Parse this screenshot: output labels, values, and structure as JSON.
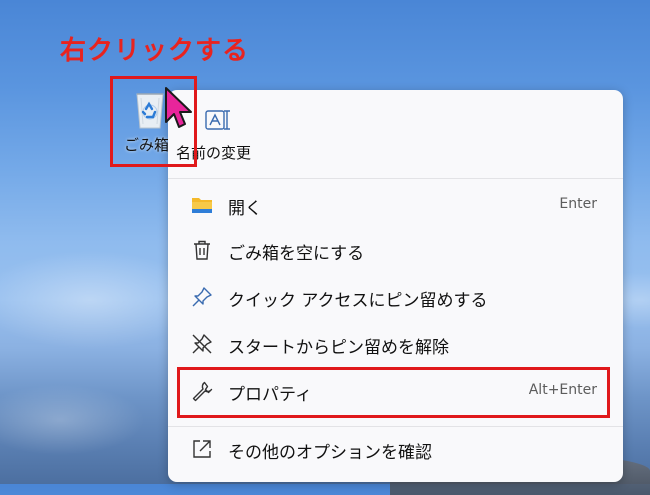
{
  "annotation": {
    "text": "右クリックする",
    "color": "#e8231f"
  },
  "desktop_icon": {
    "label": "ごみ箱",
    "icon": "recycle-bin-icon"
  },
  "context_menu": {
    "rename": {
      "label": "名前の変更",
      "icon": "rename-icon"
    },
    "items": [
      {
        "label": "開く",
        "shortcut": "Enter",
        "icon": "folder-icon"
      },
      {
        "label": "ごみ箱を空にする",
        "shortcut": "",
        "icon": "trash-icon"
      },
      {
        "label": "クイック アクセスにピン留めする",
        "shortcut": "",
        "icon": "pin-icon"
      },
      {
        "label": "スタートからピン留めを解除",
        "shortcut": "",
        "icon": "unpin-icon"
      },
      {
        "label": "プロパティ",
        "shortcut": "Alt+Enter",
        "icon": "wrench-icon"
      },
      {
        "label": "その他のオプションを確認",
        "shortcut": "",
        "icon": "share-icon"
      }
    ]
  },
  "colors": {
    "highlight_border": "#e0191b",
    "cursor_fill": "#e8259b",
    "folder_yellow": "#f4b92a",
    "menu_background": "#f9f9fb"
  }
}
